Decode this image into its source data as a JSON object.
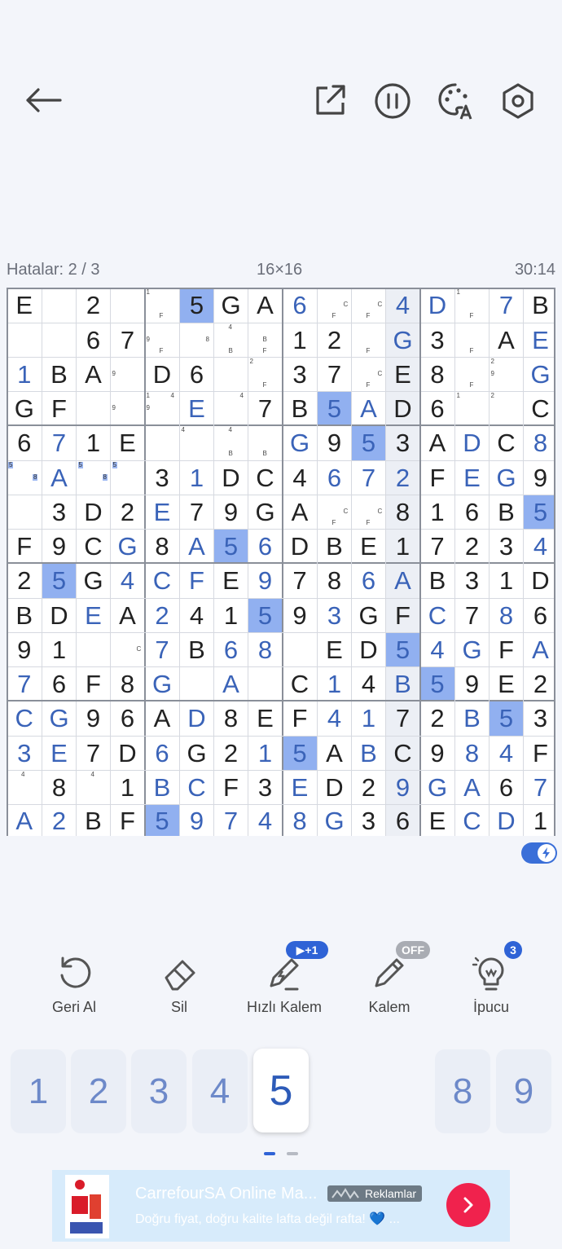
{
  "header": {
    "back_icon": "arrow-left-icon",
    "share_icon": "share-external-icon",
    "pause_icon": "pause-icon",
    "theme_icon": "palette-icon",
    "settings_icon": "gear-hexagon-icon"
  },
  "status": {
    "mistakes": "Hatalar: 2 / 3",
    "size": "16×16",
    "time": "30:14"
  },
  "board": {
    "rows": [
      [
        "E",
        "",
        "2",
        "",
        "",
        "5",
        "G",
        "A",
        "6",
        "",
        "",
        "4",
        "D",
        "",
        "7",
        "B"
      ],
      [
        "",
        "",
        "6",
        "7",
        "",
        "",
        "",
        "",
        "1",
        "2",
        "",
        "G",
        "3",
        "",
        "A",
        "E"
      ],
      [
        "1",
        "B",
        "A",
        "",
        "D",
        "6",
        "",
        "",
        "3",
        "7",
        "",
        "E",
        "8",
        "",
        "",
        "G"
      ],
      [
        "G",
        "F",
        "",
        "",
        "",
        "E",
        "",
        "7",
        "B",
        "5",
        "A",
        "D",
        "6",
        "",
        "",
        "C"
      ],
      [
        "6",
        "7",
        "1",
        "E",
        "",
        "",
        "",
        "",
        "G",
        "9",
        "5",
        "3",
        "A",
        "D",
        "C",
        "8"
      ],
      [
        "",
        "A",
        "",
        "",
        "3",
        "1",
        "D",
        "C",
        "4",
        "6",
        "7",
        "2",
        "F",
        "E",
        "G",
        "9"
      ],
      [
        "",
        "3",
        "D",
        "2",
        "E",
        "7",
        "9",
        "G",
        "A",
        "",
        "",
        "8",
        "1",
        "6",
        "B",
        "5"
      ],
      [
        "F",
        "9",
        "C",
        "G",
        "8",
        "A",
        "5",
        "6",
        "D",
        "B",
        "E",
        "1",
        "7",
        "2",
        "3",
        "4"
      ],
      [
        "2",
        "5",
        "G",
        "4",
        "C",
        "F",
        "E",
        "9",
        "7",
        "8",
        "6",
        "A",
        "B",
        "3",
        "1",
        "D"
      ],
      [
        "B",
        "D",
        "E",
        "A",
        "2",
        "4",
        "1",
        "5",
        "9",
        "3",
        "G",
        "F",
        "C",
        "7",
        "8",
        "6"
      ],
      [
        "9",
        "1",
        "",
        "",
        "7",
        "B",
        "6",
        "8",
        "",
        "E",
        "D",
        "5",
        "4",
        "G",
        "F",
        "A"
      ],
      [
        "7",
        "6",
        "F",
        "8",
        "G",
        "",
        "A",
        "",
        "C",
        "1",
        "4",
        "B",
        "5",
        "9",
        "E",
        "2"
      ],
      [
        "C",
        "G",
        "9",
        "6",
        "A",
        "D",
        "8",
        "E",
        "F",
        "4",
        "1",
        "7",
        "2",
        "B",
        "5",
        "3"
      ],
      [
        "3",
        "E",
        "7",
        "D",
        "6",
        "G",
        "2",
        "1",
        "5",
        "A",
        "B",
        "C",
        "9",
        "8",
        "4",
        "F"
      ],
      [
        "",
        "8",
        "",
        "1",
        "B",
        "C",
        "F",
        "3",
        "E",
        "D",
        "2",
        "9",
        "G",
        "A",
        "6",
        "7"
      ],
      [
        "A",
        "2",
        "B",
        "F",
        "5",
        "9",
        "7",
        "4",
        "8",
        "G",
        "3",
        "6",
        "E",
        "C",
        "D",
        "1"
      ]
    ],
    "entered": [
      "0,8",
      "0,11",
      "0,12",
      "0,14",
      "1,11",
      "1,15",
      "2,0",
      "2,15",
      "3,5",
      "3,9",
      "3,10",
      "4,1",
      "4,8",
      "4,10",
      "4,13",
      "4,15",
      "5,1",
      "5,5",
      "5,9",
      "5,10",
      "5,11",
      "5,13",
      "5,14",
      "6,4",
      "6,15",
      "7,3",
      "7,5",
      "7,6",
      "7,7",
      "7,15",
      "8,1",
      "8,3",
      "8,4",
      "8,5",
      "8,7",
      "8,10",
      "8,11",
      "9,2",
      "9,4",
      "9,7",
      "9,9",
      "9,12",
      "9,14",
      "10,4",
      "10,6",
      "10,7",
      "10,11",
      "10,12",
      "10,13",
      "10,15",
      "11,0",
      "11,4",
      "11,6",
      "11,9",
      "11,11",
      "11,12",
      "12,0",
      "12,1",
      "12,5",
      "12,9",
      "12,10",
      "12,13",
      "12,14",
      "13,0",
      "13,1",
      "13,4",
      "13,7",
      "13,8",
      "13,10",
      "13,13",
      "13,14",
      "14,4",
      "14,5",
      "14,8",
      "14,11",
      "14,12",
      "14,13",
      "14,15",
      "15,0",
      "15,1",
      "15,4",
      "15,5",
      "15,6",
      "15,7",
      "15,8",
      "15,9",
      "15,13",
      "15,14"
    ],
    "highlighted": [
      "0,5",
      "3,9",
      "4,10",
      "6,15",
      "7,6",
      "8,1",
      "9,7",
      "10,11",
      "11,12",
      "12,14",
      "13,8",
      "15,4"
    ],
    "notes": [
      {
        "r": 0,
        "c": 4,
        "tl": "1",
        "bm": "F"
      },
      {
        "r": 0,
        "c": 9,
        "bm": "F",
        "mr": "C"
      },
      {
        "r": 0,
        "c": 10,
        "bm": "F",
        "mr": "C"
      },
      {
        "r": 0,
        "c": 13,
        "tl": "1",
        "bm": "F"
      },
      {
        "r": 1,
        "c": 4,
        "ml": "9",
        "bm": "F"
      },
      {
        "r": 1,
        "c": 5,
        "mr": "8"
      },
      {
        "r": 1,
        "c": 6,
        "tm": "4",
        "bm": "B"
      },
      {
        "r": 1,
        "c": 7,
        "mm": "B",
        "bm": "F"
      },
      {
        "r": 1,
        "c": 10,
        "bm": "F"
      },
      {
        "r": 1,
        "c": 13,
        "bm": "F"
      },
      {
        "r": 2,
        "c": 3,
        "ml": "9"
      },
      {
        "r": 2,
        "c": 7,
        "tl": "2",
        "bm": "F"
      },
      {
        "r": 2,
        "c": 10,
        "bm": "F",
        "mr": "C"
      },
      {
        "r": 2,
        "c": 13,
        "bm": "F"
      },
      {
        "r": 2,
        "c": 14,
        "tl": "2",
        "ml": "9"
      },
      {
        "r": 3,
        "c": 3,
        "ml": "9"
      },
      {
        "r": 3,
        "c": 4,
        "tl": "1",
        "tr": "4",
        "ml": "9"
      },
      {
        "r": 3,
        "c": 6,
        "tr": "4"
      },
      {
        "r": 3,
        "c": 13,
        "tl": "1"
      },
      {
        "r": 3,
        "c": 14,
        "tl": "2"
      },
      {
        "r": 4,
        "c": 5,
        "tl": "4"
      },
      {
        "r": 4,
        "c": 6,
        "tm": "4",
        "bm": "B"
      },
      {
        "r": 4,
        "c": 7,
        "bm": "B"
      },
      {
        "r": 5,
        "c": 0,
        "tl": "5",
        "mr": "8",
        "hl": true
      },
      {
        "r": 5,
        "c": 2,
        "tl": "5",
        "mr": "8",
        "hl": true
      },
      {
        "r": 5,
        "c": 3,
        "tl": "5",
        "hl": true
      },
      {
        "r": 6,
        "c": 9,
        "mr": "C",
        "bm": "F"
      },
      {
        "r": 6,
        "c": 10,
        "mr": "C",
        "bm": "F"
      },
      {
        "r": 10,
        "c": 3,
        "mr": "C"
      },
      {
        "r": 14,
        "c": 0,
        "tm": "4"
      },
      {
        "r": 14,
        "c": 2,
        "tm": "4"
      }
    ]
  },
  "tools": [
    {
      "label": "Geri Al",
      "icon": "undo-icon"
    },
    {
      "label": "Sil",
      "icon": "eraser-icon"
    },
    {
      "label": "Hızlı Kalem",
      "icon": "quick-pencil-icon",
      "badge": "▶+1"
    },
    {
      "label": "Kalem",
      "icon": "pencil-icon",
      "badge": "OFF"
    },
    {
      "label": "İpucu",
      "icon": "lightbulb-icon",
      "badge": "3"
    }
  ],
  "numpad": [
    "1",
    "2",
    "3",
    "4",
    "5",
    "",
    "8",
    "9"
  ],
  "numpad_active": "5",
  "ad": {
    "title": "CarrefourSA Online Ma...",
    "tag": "Reklamlar",
    "subtitle": "Doğru fiyat, doğru kalite lafta değil rafta! 💙 ...",
    "cta_icon": "chevron-right-icon"
  },
  "colors": {
    "accent": "#3a6fd8",
    "entered_digit": "#3a63b8",
    "highlight_cell": "#91b0f0",
    "ad_cta": "#f0224d"
  }
}
